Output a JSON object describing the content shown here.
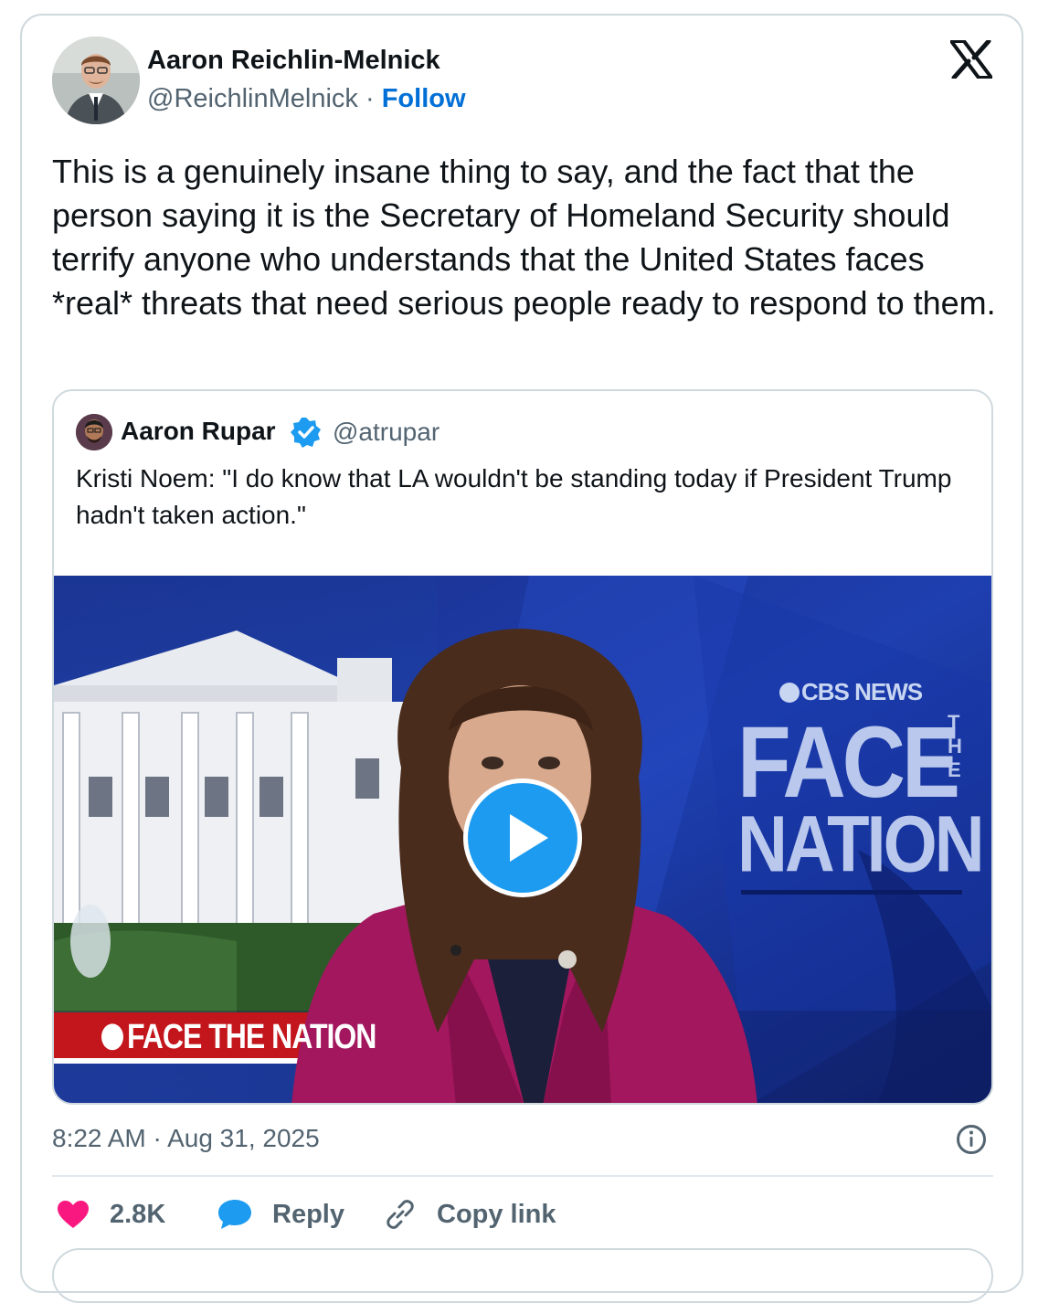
{
  "tweet": {
    "author_name": "Aaron Reichlin-Melnick",
    "author_handle": "@ReichlinMelnick",
    "separator": "·",
    "follow_label": "Follow",
    "text": "This is a genuinely insane thing to say, and the fact that the person saying it is the Secretary of Homeland Security should terrify anyone who understands that the United States faces *real* threats that need serious people ready to respond to them.",
    "timestamp": "8:22 AM · Aug 31, 2025"
  },
  "quote": {
    "author_name": "Aaron Rupar",
    "author_handle": "@atrupar",
    "text": "Kristi Noem: \"I do know that LA wouldn't be standing today if President Trump hadn't taken action.\"",
    "media": {
      "network_label": "CBS NEWS",
      "show_title_line1": "FACE",
      "show_title_the": "THE",
      "show_title_line2": "NATION",
      "lower_third": "FACE THE NATION"
    }
  },
  "actions": {
    "like_count": "2.8K",
    "reply_label": "Reply",
    "copy_label": "Copy link"
  },
  "colors": {
    "accent": "#006fd6",
    "verified": "#1d9bf0",
    "like": "#f91880",
    "muted": "#536471",
    "border": "#cfd9de"
  },
  "icons": [
    "x-logo-icon",
    "verified-badge-icon",
    "play-icon",
    "info-icon",
    "heart-icon",
    "reply-bubble-icon",
    "link-icon"
  ]
}
